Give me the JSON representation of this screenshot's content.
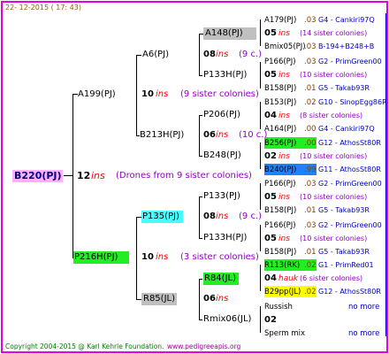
{
  "header": {
    "date": "22- 12-2015 ( 17: 43)"
  },
  "footer": {
    "copyright": "Copyright 2004-2015 @ Karl Kehrle Foundation.",
    "site": "www.pedigreeapis.org"
  },
  "colors": {
    "frame": "#e000e0",
    "root_bg": "#ffb0ff",
    "green_bg": "#22ee22",
    "cyan_bg": "#44ffff",
    "grey_bg": "#c0c0c0",
    "yellow_bg": "#ffff00",
    "blue_bg": "#2080ff",
    "ins": "#ff0000",
    "sister": "#9000c0",
    "brown": "#804000",
    "line_right": "#0000c0"
  },
  "root": {
    "id": "B220(PJ)",
    "year": "12",
    "ins": "ins",
    "note": "(Drones from 9 sister colonies)"
  },
  "gen1": [
    {
      "id": "A199(PJ)",
      "year": "10",
      "ins": "ins",
      "note": "(9 sister colonies)"
    },
    {
      "id": "P216H(PJ)",
      "year": "10",
      "ins": "ins",
      "note": "(3 sister colonies)"
    }
  ],
  "gen2": [
    {
      "id": "A6(PJ)",
      "year": "08",
      "ins": "ins",
      "note": "(9 c.)"
    },
    {
      "id": "B213H(PJ)",
      "year": "06",
      "ins": "ins",
      "note": "(10 c.)"
    },
    {
      "id": "P135(PJ)",
      "year": "08",
      "ins": "ins",
      "note": "(9 c.)"
    },
    {
      "id": "R85(JL)",
      "year": "06",
      "ins": "ins",
      "note": ""
    }
  ],
  "gen3": [
    {
      "id": "A148(PJ)"
    },
    {
      "id": "P133H(PJ)"
    },
    {
      "id": "P206(PJ)"
    },
    {
      "id": "B248(PJ)"
    },
    {
      "id": "P133(PJ)"
    },
    {
      "id": "P133H(PJ)"
    },
    {
      "id": "R84(JL)"
    },
    {
      "id": "Rmix06(JL)"
    }
  ],
  "gen4": [
    {
      "top": [
        "A179(PJ)",
        ".03",
        "G4 - Cankiri97Q"
      ],
      "mid": [
        "05",
        "ins",
        "(14 sister colonies)"
      ],
      "bot": [
        "Bmix05(PJ)",
        ".03",
        "B-194+B248+B"
      ]
    },
    {
      "top": [
        "P166(PJ)",
        ".03",
        "G2 - PrimGreen00"
      ],
      "mid": [
        "05",
        "ins",
        "(10 sister colonies)"
      ],
      "bot": [
        "B158(PJ)",
        ".01",
        "G5 - Takab93R"
      ]
    },
    {
      "top": [
        "B153(PJ)",
        ".02",
        "G10 - SinopEgg86R"
      ],
      "mid": [
        "04",
        "ins",
        "(8 sister colonies)"
      ],
      "bot": [
        "A164(PJ)",
        ".00",
        "G4 - Cankiri97Q"
      ]
    },
    {
      "top": [
        "B256(PJ)",
        ".00",
        "G12 - AthosSt80R"
      ],
      "mid": [
        "02",
        "ins",
        "(10 sister colonies)"
      ],
      "bot": [
        "B240(PJ)",
        ".99",
        "G11 - AthosSt80R"
      ]
    },
    {
      "top": [
        "P166(PJ)",
        ".03",
        "G2 - PrimGreen00"
      ],
      "mid": [
        "05",
        "ins",
        "(10 sister colonies)"
      ],
      "bot": [
        "B158(PJ)",
        ".01",
        "G5 - Takab93R"
      ]
    },
    {
      "top": [
        "P166(PJ)",
        ".03",
        "G2 - PrimGreen00"
      ],
      "mid": [
        "05",
        "ins",
        "(10 sister colonies)"
      ],
      "bot": [
        "B158(PJ)",
        ".01",
        "G5 - Takab93R"
      ]
    },
    {
      "top": [
        "R113(RK)",
        ".02",
        "G1 - PrimRed01"
      ],
      "mid": [
        "04",
        "hauk",
        "(6 sister colonies)"
      ],
      "bot": [
        "B29pp(JL)",
        ".02",
        "G12 - AthosSt80R"
      ]
    },
    {
      "top": [
        "Russish",
        "",
        "no more"
      ],
      "mid": [
        "02",
        "",
        ""
      ],
      "bot": [
        "Sperm mix",
        "",
        "no more"
      ]
    }
  ]
}
